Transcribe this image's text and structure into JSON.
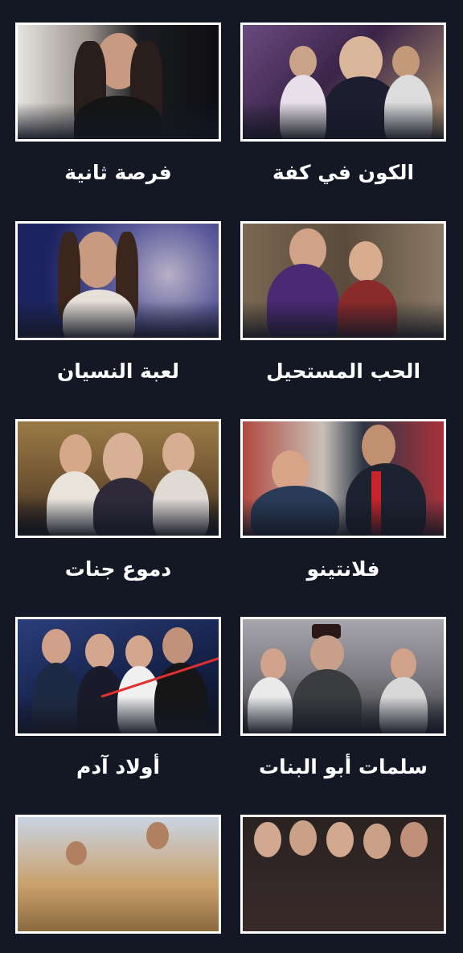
{
  "shows": [
    {
      "title": "الكون في كفة",
      "thumb_icon": "show-poster-image",
      "palette": [
        "#5a3f6e",
        "#b9a07a",
        "#2a1a2e"
      ]
    },
    {
      "title": "فرصة ثانية",
      "thumb_icon": "show-poster-image",
      "palette": [
        "#1d1f24",
        "#d9d6d0",
        "#8a6a5a"
      ]
    },
    {
      "title": "الحب المستحيل",
      "thumb_icon": "show-poster-image",
      "palette": [
        "#6b5a48",
        "#4a2c6a",
        "#a83a3a"
      ]
    },
    {
      "title": "لعبة النسيان",
      "thumb_icon": "show-poster-image",
      "palette": [
        "#2a2f7a",
        "#c9c4d8",
        "#5a4a4a"
      ]
    },
    {
      "title": "فلانتينو",
      "thumb_icon": "show-poster-image",
      "palette": [
        "#b1554a",
        "#2f3a4a",
        "#3a6a8a"
      ]
    },
    {
      "title": "دموع جنات",
      "thumb_icon": "show-poster-image",
      "palette": [
        "#8a6a3a",
        "#c7a070",
        "#3a2a20"
      ]
    },
    {
      "title": "سلمات أبو البنات",
      "thumb_icon": "show-poster-image",
      "palette": [
        "#9a9aa0",
        "#3a3a3e",
        "#6a6a70"
      ]
    },
    {
      "title": "أولاد آدم",
      "thumb_icon": "show-poster-image",
      "palette": [
        "#1b2a5a",
        "#c94040",
        "#101828"
      ]
    },
    {
      "title": "",
      "thumb_icon": "show-poster-image",
      "palette": [
        "#3a2a2a",
        "#c9a48a",
        "#1a1a1a"
      ]
    },
    {
      "title": "",
      "thumb_icon": "show-poster-image",
      "palette": [
        "#c9a06a",
        "#6a9ac9",
        "#8a7a5a"
      ]
    }
  ]
}
